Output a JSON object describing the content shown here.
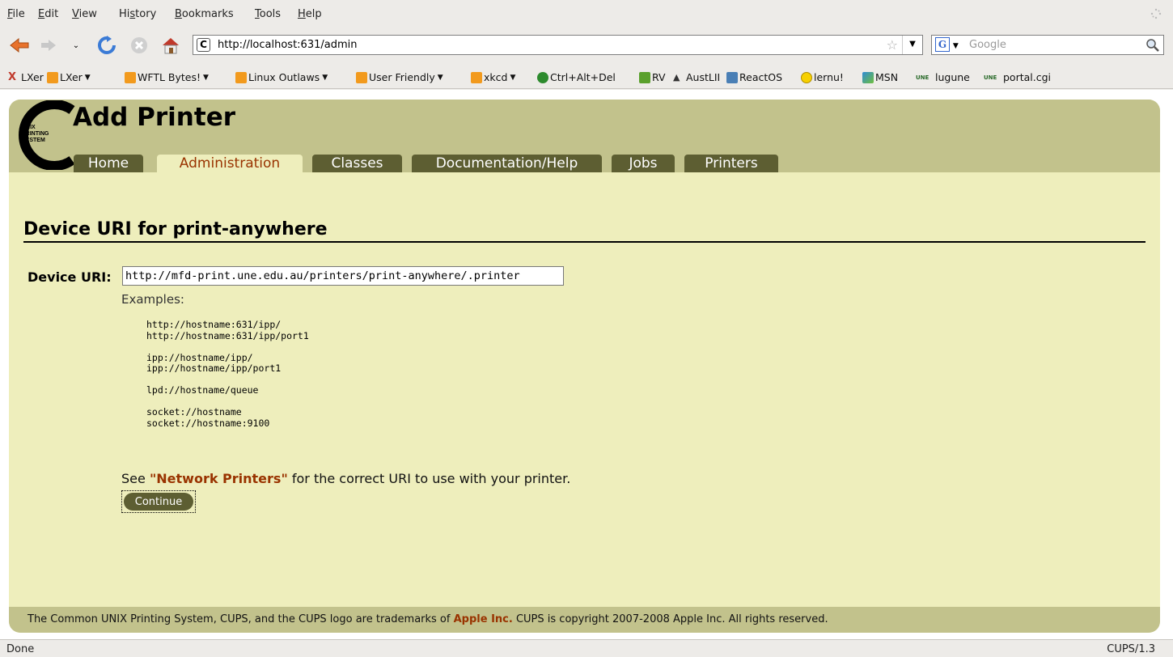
{
  "menubar": {
    "items": [
      {
        "pre": "",
        "u": "F",
        "post": "ile"
      },
      {
        "pre": "",
        "u": "E",
        "post": "dit"
      },
      {
        "pre": "",
        "u": "V",
        "post": "iew"
      },
      {
        "pre": "Hi",
        "u": "s",
        "post": "tory"
      },
      {
        "pre": "",
        "u": "B",
        "post": "ookmarks"
      },
      {
        "pre": "",
        "u": "T",
        "post": "ools"
      },
      {
        "pre": "",
        "u": "H",
        "post": "elp"
      }
    ]
  },
  "navbar": {
    "url": "http://localhost:631/admin",
    "search_placeholder": "Google"
  },
  "bookmarks": {
    "items": [
      {
        "label": "LXer",
        "icon": "lxer-x-icon",
        "dropdown": false
      },
      {
        "label": "LXer",
        "icon": "rss-feed-icon",
        "dropdown": true
      },
      {
        "label": "WFTL Bytes!",
        "icon": "rss-feed-icon",
        "dropdown": true
      },
      {
        "label": "Linux Outlaws",
        "icon": "rss-feed-icon",
        "dropdown": true
      },
      {
        "label": "User Friendly",
        "icon": "rss-feed-icon",
        "dropdown": true
      },
      {
        "label": "xkcd",
        "icon": "rss-feed-icon",
        "dropdown": true
      },
      {
        "label": "Ctrl+Alt+Del",
        "icon": "cad-icon",
        "dropdown": false
      },
      {
        "label": "RV",
        "icon": "rv-icon",
        "dropdown": false
      },
      {
        "label": "AustLII",
        "icon": "austlii-icon",
        "dropdown": false
      },
      {
        "label": "ReactOS",
        "icon": "reactos-icon",
        "dropdown": false
      },
      {
        "label": "lernu!",
        "icon": "smiley-icon",
        "dropdown": false
      },
      {
        "label": "MSN",
        "icon": "msn-icon",
        "dropdown": false
      },
      {
        "label": "lugune",
        "icon": "une-icon",
        "dropdown": false
      },
      {
        "label": "portal.cgi",
        "icon": "une-icon",
        "dropdown": false
      }
    ]
  },
  "page": {
    "logo_text": [
      "UNIX",
      "PRINTING",
      "SYSTEM"
    ],
    "title": "Add Printer",
    "tabs": [
      {
        "label": "Home",
        "active": false
      },
      {
        "label": "Administration",
        "active": true
      },
      {
        "label": "Classes",
        "active": false
      },
      {
        "label": "Documentation/Help",
        "active": false
      },
      {
        "label": "Jobs",
        "active": false
      },
      {
        "label": "Printers",
        "active": false
      }
    ],
    "section_title": "Device URI for print-anywhere",
    "uri_label": "Device URI:",
    "uri_value": "http://mfd-print.une.edu.au/printers/print-anywhere/.printer",
    "examples_label": "Examples:",
    "examples": [
      [
        "http://hostname:631/ipp/",
        "http://hostname:631/ipp/port1"
      ],
      [
        "ipp://hostname/ipp/",
        "ipp://hostname/ipp/port1"
      ],
      [
        "lpd://hostname/queue"
      ],
      [
        "socket://hostname",
        "socket://hostname:9100"
      ]
    ],
    "see_prefix": "See ",
    "see_link": "\"Network Printers\"",
    "see_suffix": " for the correct URI to use with your printer.",
    "continue_label": "Continue",
    "footer_prefix": "The Common UNIX Printing System, CUPS, and the CUPS logo are trademarks of ",
    "footer_link": "Apple Inc.",
    "footer_suffix": " CUPS is copyright 2007-2008 Apple Inc. All rights reserved.",
    "colors": {
      "header": "#c2c28c",
      "body": "#eeeebc",
      "tab": "#5d5e32",
      "accent": "#993300"
    }
  },
  "statusbar": {
    "left": "Done",
    "right": "CUPS/1.3"
  }
}
